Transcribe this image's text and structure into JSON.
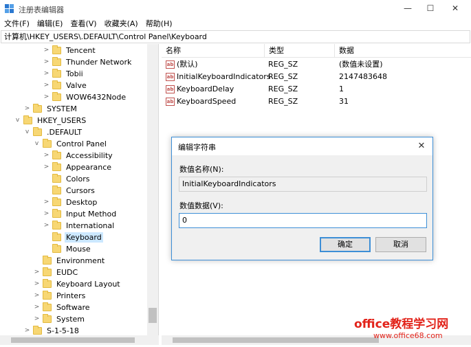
{
  "window": {
    "title": "注册表编辑器",
    "controls": {
      "minimize": "—",
      "maximize": "☐",
      "close": "✕"
    }
  },
  "menu": [
    "文件(F)",
    "编辑(E)",
    "查看(V)",
    "收藏夹(A)",
    "帮助(H)"
  ],
  "address": "计算机\\HKEY_USERS\\.DEFAULT\\Control Panel\\Keyboard",
  "tree": [
    {
      "label": "Tencent",
      "expander": ">"
    },
    {
      "label": "Thunder Network",
      "expander": ">"
    },
    {
      "label": "Tobii",
      "expander": ">"
    },
    {
      "label": "Valve",
      "expander": ">"
    },
    {
      "label": "WOW6432Node",
      "expander": ">"
    },
    {
      "label": "SYSTEM",
      "expander": ">"
    },
    {
      "label": "HKEY_USERS",
      "expander": "v"
    },
    {
      "label": ".DEFAULT",
      "expander": "v"
    },
    {
      "label": "Control Panel",
      "expander": "v"
    },
    {
      "label": "Accessibility",
      "expander": ">"
    },
    {
      "label": "Appearance",
      "expander": ">"
    },
    {
      "label": "Colors",
      "expander": ""
    },
    {
      "label": "Cursors",
      "expander": ""
    },
    {
      "label": "Desktop",
      "expander": ">"
    },
    {
      "label": "Input Method",
      "expander": ">"
    },
    {
      "label": "International",
      "expander": ">"
    },
    {
      "label": "Keyboard",
      "expander": "",
      "selected": true
    },
    {
      "label": "Mouse",
      "expander": ""
    },
    {
      "label": "Environment",
      "expander": ""
    },
    {
      "label": "EUDC",
      "expander": ">"
    },
    {
      "label": "Keyboard Layout",
      "expander": ">"
    },
    {
      "label": "Printers",
      "expander": ">"
    },
    {
      "label": "Software",
      "expander": ">"
    },
    {
      "label": "System",
      "expander": ">"
    },
    {
      "label": "S-1-5-18",
      "expander": ">"
    }
  ],
  "list": {
    "headers": {
      "name": "名称",
      "type": "类型",
      "data": "数据"
    },
    "rows": [
      {
        "name": "(默认)",
        "type": "REG_SZ",
        "data": "(数值未设置)"
      },
      {
        "name": "InitialKeyboardIndicators",
        "type": "REG_SZ",
        "data": "2147483648"
      },
      {
        "name": "KeyboardDelay",
        "type": "REG_SZ",
        "data": "1"
      },
      {
        "name": "KeyboardSpeed",
        "type": "REG_SZ",
        "data": "31"
      }
    ],
    "value_icon": "ab"
  },
  "dialog": {
    "title": "编辑字符串",
    "close": "✕",
    "name_label": "数值名称(N):",
    "name_value": "InitialKeyboardIndicators",
    "data_label": "数值数据(V):",
    "data_value": "0",
    "ok_label": "确定",
    "cancel_label": "取消"
  },
  "watermark": {
    "main": "office教程学习网",
    "sub": "www.office68.com"
  },
  "colors": {
    "selection": "#cce8ff",
    "accent": "#3c8ed6",
    "folder": "#f7d774",
    "watermark": "#e2231a"
  }
}
